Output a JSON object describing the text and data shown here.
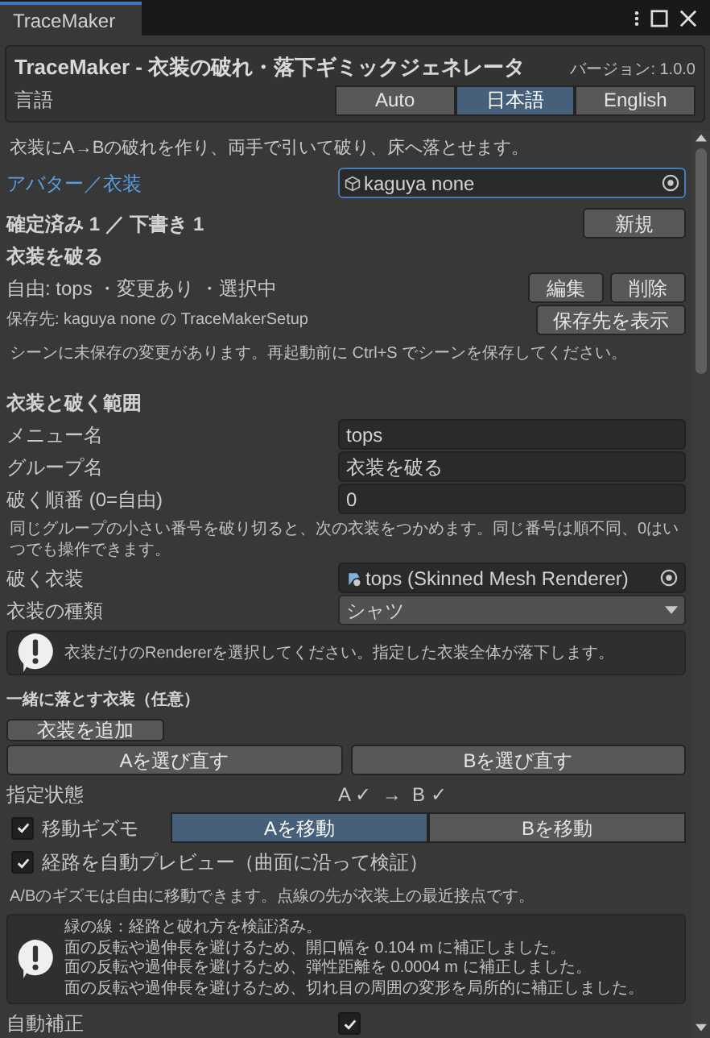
{
  "window": {
    "title": "TraceMaker"
  },
  "header": {
    "title": "TraceMaker - 衣装の破れ・落下ギミックジェネレータ",
    "version": "バージョン: 1.0.0",
    "language_label": "言語",
    "languages": [
      {
        "label": "Auto",
        "selected": false
      },
      {
        "label": "日本語",
        "selected": true
      },
      {
        "label": "English",
        "selected": false
      }
    ]
  },
  "intro": "衣装にA→Bの破れを作り、両手で引いて破り、床へ落とせます。",
  "avatar": {
    "label": "アバター／衣装",
    "value": "kaguya none"
  },
  "status": {
    "text": "確定済み 1 ／ 下書き 1",
    "button": "新規"
  },
  "tear_section": {
    "title": "衣装を破る",
    "entry": "自由: tops ・変更あり ・選択中",
    "entry_buttons": [
      "編集",
      "削除"
    ],
    "save_path": "保存先: kaguya none の TraceMakerSetup",
    "save_button": "保存先を表示",
    "scene_note": "シーンに未保存の変更があります。再起動前に Ctrl+S でシーンを保存してください。"
  },
  "range_section": {
    "title": "衣装と破く範囲",
    "fields": [
      {
        "kind": "text",
        "label": "メニュー名",
        "value": "tops"
      },
      {
        "kind": "text",
        "label": "グループ名",
        "value": "衣装を破る"
      },
      {
        "kind": "text",
        "label": "破く順番 (0=自由)",
        "value": "0"
      }
    ],
    "order_note": "同じグループの小さい番号を破り切ると、次の衣装をつかめます。同じ番号は順不同、0はいつでも操作できます。",
    "fields2": [
      {
        "kind": "object",
        "label": "破く衣装",
        "value": "tops (Skinned Mesh Renderer)"
      },
      {
        "kind": "dropdown",
        "label": "衣装の種類",
        "value": "シャツ"
      }
    ],
    "help": "衣装だけのRendererを選択してください。指定した衣装全体が落下します。"
  },
  "together": {
    "title": "一緒に落とす衣装（任意）",
    "add_button": "衣装を追加"
  },
  "reselect_buttons": [
    "Aを選び直す",
    "Bを選び直す"
  ],
  "state": {
    "label": "指定状態",
    "value": "A ✓  →  B ✓"
  },
  "gizmo": {
    "checked": true,
    "label": "移動ギズモ",
    "modes": [
      {
        "label": "Aを移動",
        "selected": true
      },
      {
        "label": "Bを移動",
        "selected": false
      }
    ]
  },
  "preview": {
    "checked": true,
    "label": "経路を自動プレビュー（曲面に沿って検証）"
  },
  "gizmo_note": "A/Bのギズモは自由に移動できます。点線の先が衣装上の最近接点です。",
  "validation": [
    "緑の線：経路と破れ方を検証済み。",
    "面の反転や過伸長を避けるため、開口幅を 0.104 m に補正しました。",
    "面の反転や過伸長を避けるため、弾性距離を 0.0004 m に補正しました。",
    "面の反転や過伸長を避けるため、切れ目の周囲の変形を局所的に補正しました。"
  ],
  "auto_fix": {
    "label": "自動補正",
    "checked": true
  }
}
